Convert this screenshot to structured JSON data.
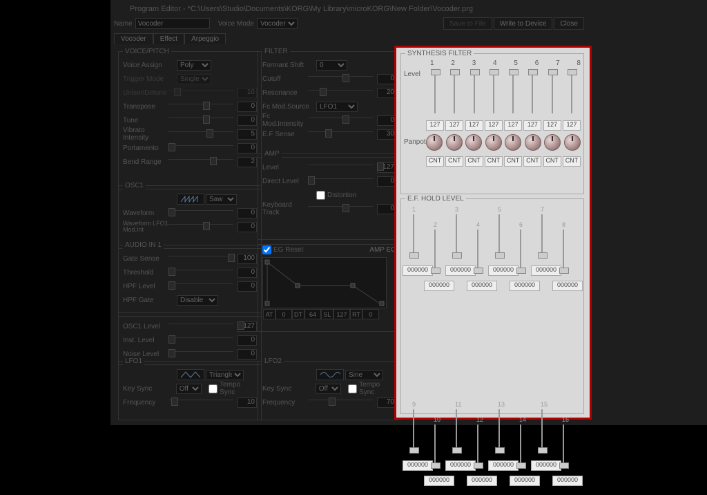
{
  "title": "Program Editor - *C:\\Users\\Studio\\Documents\\KORG\\My Library\\microKORG\\New Folder\\Vocoder.prg",
  "name_label": "Name",
  "name_value": "Vocoder",
  "voice_mode_label": "Voice Mode",
  "voice_mode_value": "Vocoder",
  "buttons": {
    "save": "Save to File",
    "write": "Write to Device",
    "close": "Close"
  },
  "tabs": [
    "Vocoder",
    "Effect",
    "Arpeggio"
  ],
  "voice_pitch": {
    "label": "VOICE/PITCH",
    "voice_assign_l": "Voice Assign",
    "voice_assign_v": "Poly",
    "trigger_mode_l": "Trigger Mode",
    "trigger_mode_v": "Single",
    "unison_l": "UnisonDetune",
    "unison_v": "10",
    "transpose_l": "Transpose",
    "transpose_v": "0",
    "tune_l": "Tune",
    "tune_v": "0",
    "vibrato_l": "Vibrato Intensity",
    "vibrato_v": "5",
    "porta_l": "Portamento",
    "porta_v": "0",
    "bend_l": "Bend Range",
    "bend_v": "2"
  },
  "osc1": {
    "label": "OSC1",
    "wave_v": "Saw",
    "waveform_l": "Waveform",
    "waveform_v": "0",
    "lfo1_l": "Waveform LFO1 Mod.Int",
    "lfo1_v": "0"
  },
  "audio": {
    "label": "AUDIO IN 1",
    "gate_l": "Gate Sense",
    "gate_v": "100",
    "thr_l": "Threshold",
    "thr_v": "0",
    "hpf_l": "HPF Level",
    "hpf_v": "0",
    "hpfg_l": "HPF Gate",
    "hpfg_v": "Disable"
  },
  "mixer": {
    "osc1_l": "OSC1 Level",
    "osc1_v": "127",
    "inst_l": "Inst. Level",
    "inst_v": "0",
    "noise_l": "Noise Level",
    "noise_v": "0"
  },
  "lfo1": {
    "label": "LFO1",
    "wave": "Triangle",
    "key_l": "Key Sync",
    "key_v": "Off",
    "tempo_l": "Tempo Sync",
    "freq_l": "Frequency",
    "freq_v": "10"
  },
  "lfo2": {
    "label": "LFO2",
    "wave": "Sine",
    "key_l": "Key Sync",
    "key_v": "Off",
    "tempo_l": "Tempo Sync",
    "freq_l": "Frequency",
    "freq_v": "70"
  },
  "filter": {
    "label": "FILTER",
    "fshift_l": "Formant Shift",
    "fshift_v": "0",
    "cut_l": "Cutoff",
    "cut_v": "0",
    "res_l": "Resonance",
    "res_v": "20",
    "fcsrc_l": "Fc Mod.Source",
    "fcsrc_v": "LFO1",
    "fcint_l": "Fc Mod.Intensity",
    "fcint_v": "0",
    "ef_l": "E.F Sense",
    "ef_v": "30"
  },
  "amp": {
    "label": "AMP",
    "lvl_l": "Level",
    "lvl_v": "127",
    "dir_l": "Direct Level",
    "dir_v": "0",
    "dist_l": "Distortion",
    "kbd_l": "Keyboard Track",
    "kbd_v": "0",
    "eg_l": "EG Reset",
    "ampeg_l": "AMP EG"
  },
  "adsr": {
    "at_l": "AT",
    "at_v": "0",
    "dt_l": "DT",
    "dt_v": "64",
    "sl_l": "SL",
    "sl_v": "127",
    "rt_l": "RT",
    "rt_v": "0"
  },
  "synth": {
    "label": "SYNTHESIS FILTER",
    "level_l": "Level",
    "panpot_l": "Panpot",
    "ch": [
      "1",
      "2",
      "3",
      "4",
      "5",
      "6",
      "7",
      "8"
    ],
    "lvl": [
      "127",
      "127",
      "127",
      "127",
      "127",
      "127",
      "127",
      "127"
    ],
    "pan": [
      "CNT",
      "CNT",
      "CNT",
      "CNT",
      "CNT",
      "CNT",
      "CNT",
      "CNT"
    ]
  },
  "efhold": {
    "label": "E.F. HOLD LEVEL",
    "ch": [
      "1",
      "2",
      "3",
      "4",
      "5",
      "6",
      "7",
      "8",
      "9",
      "10",
      "11",
      "12",
      "13",
      "14",
      "15",
      "16"
    ],
    "val": [
      "000000",
      "000000",
      "000000",
      "000000",
      "000000",
      "000000",
      "000000",
      "000000",
      "000000",
      "000000",
      "000000",
      "000000",
      "000000",
      "000000",
      "000000",
      "000000"
    ]
  }
}
